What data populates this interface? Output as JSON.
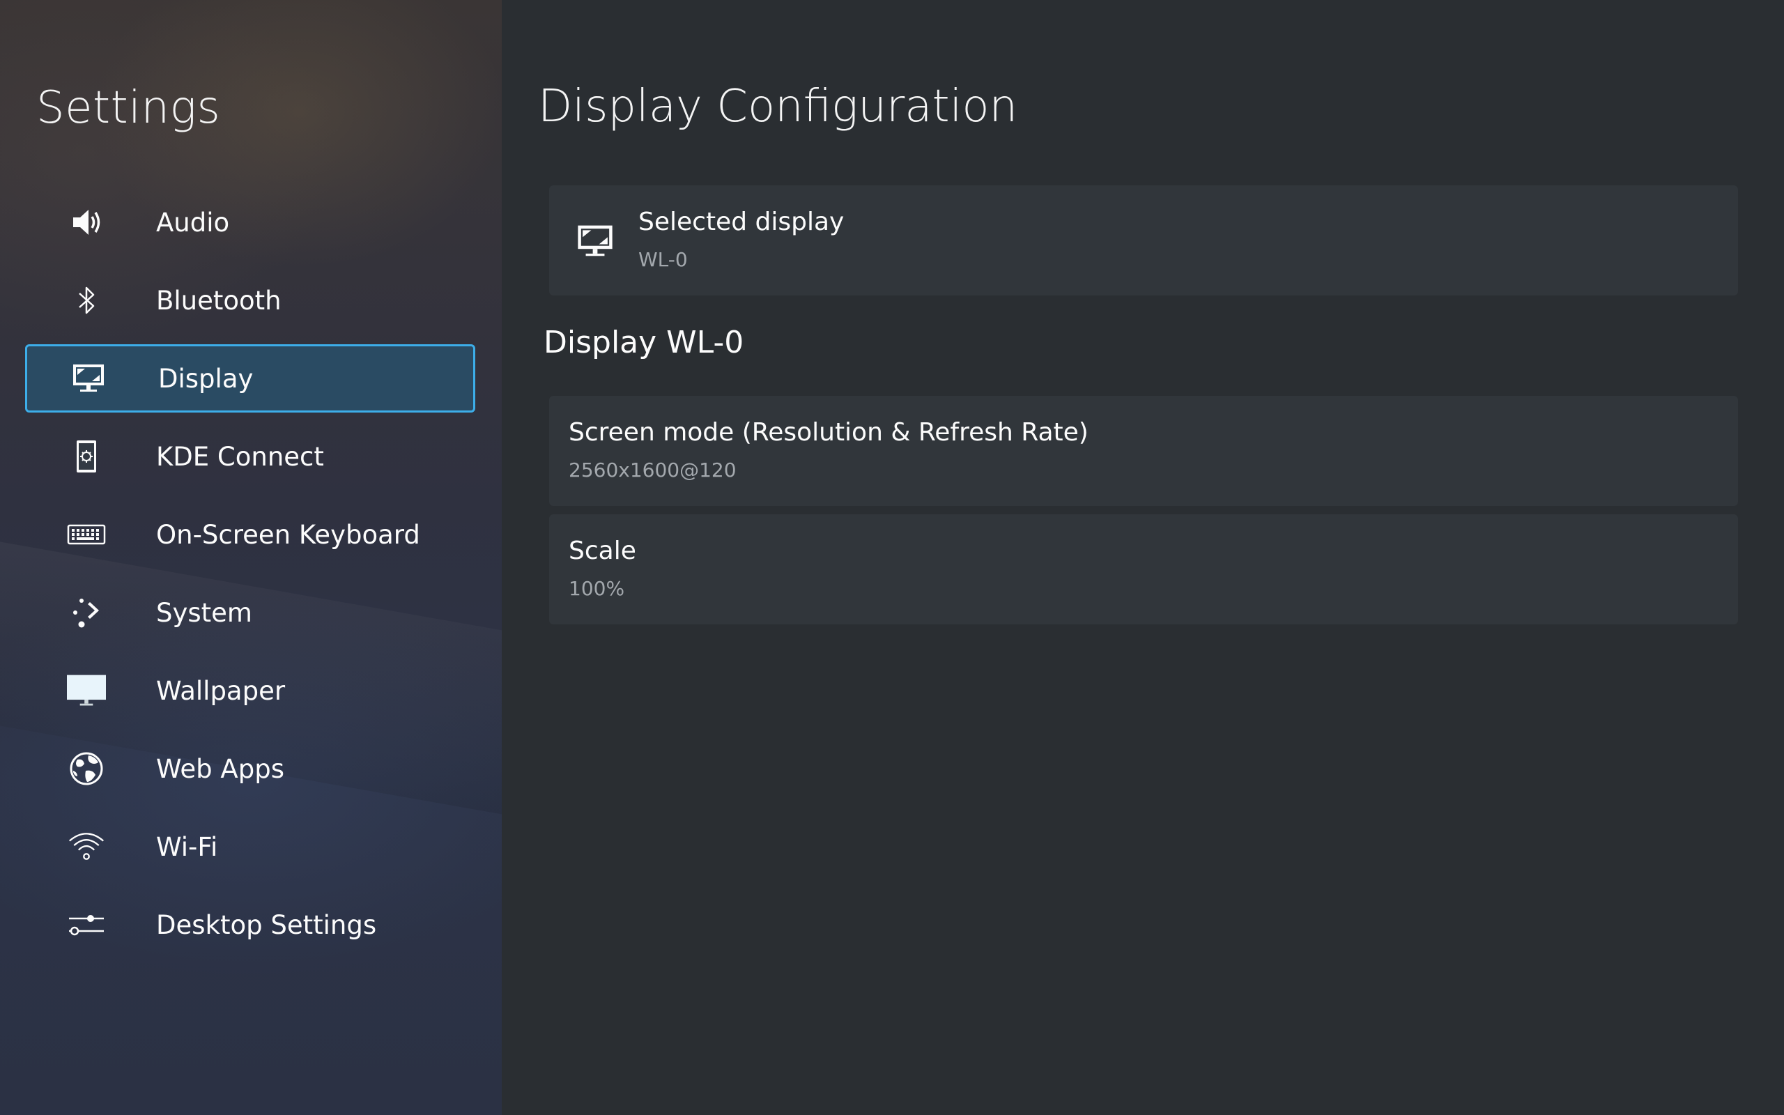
{
  "sidebar": {
    "title": "Settings",
    "items": [
      {
        "label": "Audio",
        "icon": "speaker-icon"
      },
      {
        "label": "Bluetooth",
        "icon": "bluetooth-icon"
      },
      {
        "label": "Display",
        "icon": "display-icon",
        "selected": true
      },
      {
        "label": "KDE Connect",
        "icon": "kde-connect-icon"
      },
      {
        "label": "On-Screen Keyboard",
        "icon": "keyboard-icon"
      },
      {
        "label": "System",
        "icon": "system-icon"
      },
      {
        "label": "Wallpaper",
        "icon": "wallpaper-icon"
      },
      {
        "label": "Web Apps",
        "icon": "globe-icon"
      },
      {
        "label": "Wi-Fi",
        "icon": "wifi-icon"
      },
      {
        "label": "Desktop Settings",
        "icon": "sliders-icon"
      }
    ]
  },
  "main": {
    "title": "Display Configuration",
    "selected_display": {
      "label": "Selected display",
      "value": "WL-0"
    },
    "section_heading": "Display WL-0",
    "screen_mode": {
      "label": "Screen mode (Resolution & Refresh Rate)",
      "value": "2560x1600@120"
    },
    "scale": {
      "label": "Scale",
      "value": "100%"
    }
  },
  "colors": {
    "accent": "#3daee9",
    "selected_bg": "#2a4b63",
    "card_bg": "#31363b",
    "main_bg": "#2a2e32",
    "subtext": "#a3a8ad"
  }
}
